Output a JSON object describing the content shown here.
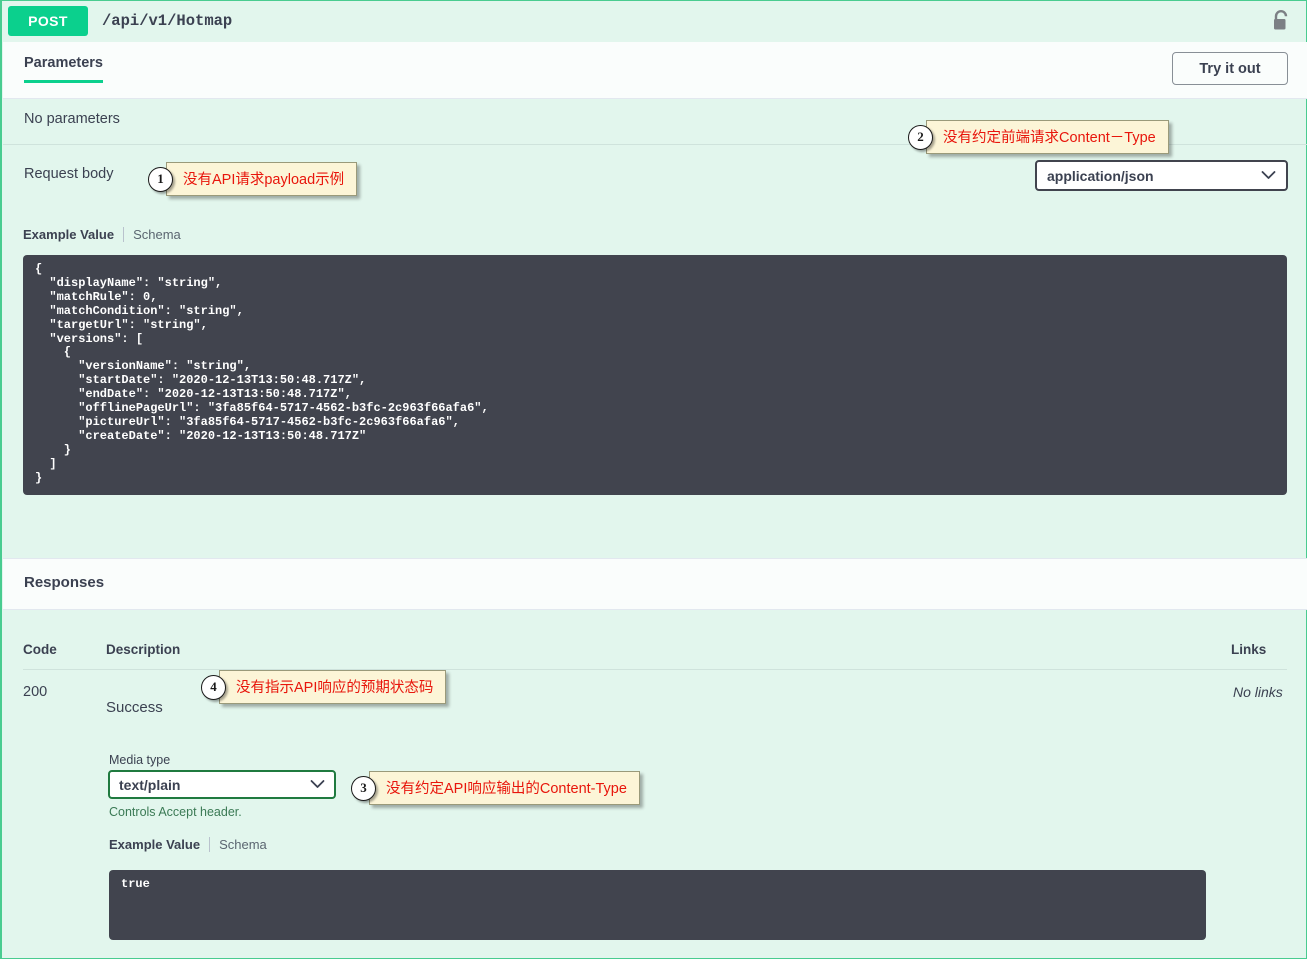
{
  "operation": {
    "method": "POST",
    "path": "/api/v1/Hotmap",
    "auth_icon": "unlocked-padlock-icon"
  },
  "toolbar": {
    "tab_parameters": "Parameters",
    "try_it_out": "Try it out"
  },
  "parameters": {
    "no_parameters": "No parameters",
    "request_body_label": "Request body",
    "content_type_value": "application/json",
    "chevron": "chevron-down-icon"
  },
  "request_example": {
    "tab_example": "Example Value",
    "tab_schema": "Schema",
    "code": "{\n  \"displayName\": \"string\",\n  \"matchRule\": 0,\n  \"matchCondition\": \"string\",\n  \"targetUrl\": \"string\",\n  \"versions\": [\n    {\n      \"versionName\": \"string\",\n      \"startDate\": \"2020-12-13T13:50:48.717Z\",\n      \"endDate\": \"2020-12-13T13:50:48.717Z\",\n      \"offlinePageUrl\": \"3fa85f64-5717-4562-b3fc-2c963f66afa6\",\n      \"pictureUrl\": \"3fa85f64-5717-4562-b3fc-2c963f66afa6\",\n      \"createDate\": \"2020-12-13T13:50:48.717Z\"\n    }\n  ]\n}"
  },
  "responses": {
    "title": "Responses",
    "columns": {
      "code": "Code",
      "description": "Description",
      "links": "Links"
    },
    "rows": [
      {
        "code": "200",
        "description": "Success",
        "links": "No links",
        "media_type_label": "Media type",
        "media_type_value": "text/plain",
        "controls_accept": "Controls Accept header.",
        "tab_example": "Example Value",
        "tab_schema": "Schema",
        "code_sample": "true"
      }
    ]
  },
  "annotations": [
    {
      "num": "1",
      "text": "没有API请求payload示例"
    },
    {
      "num": "2",
      "text": "没有约定前端请求Content－Type"
    },
    {
      "num": "3",
      "text": "没有约定API响应输出的Content-Type"
    },
    {
      "num": "4",
      "text": "没有指示API响应的预期状态码"
    }
  ],
  "colors": {
    "method_green": "#0bd08d",
    "block_bg": "#e2f6ed",
    "code_bg": "#41444e",
    "annotation_bg": "#fcf5d7",
    "annotation_text": "#e8160c"
  }
}
